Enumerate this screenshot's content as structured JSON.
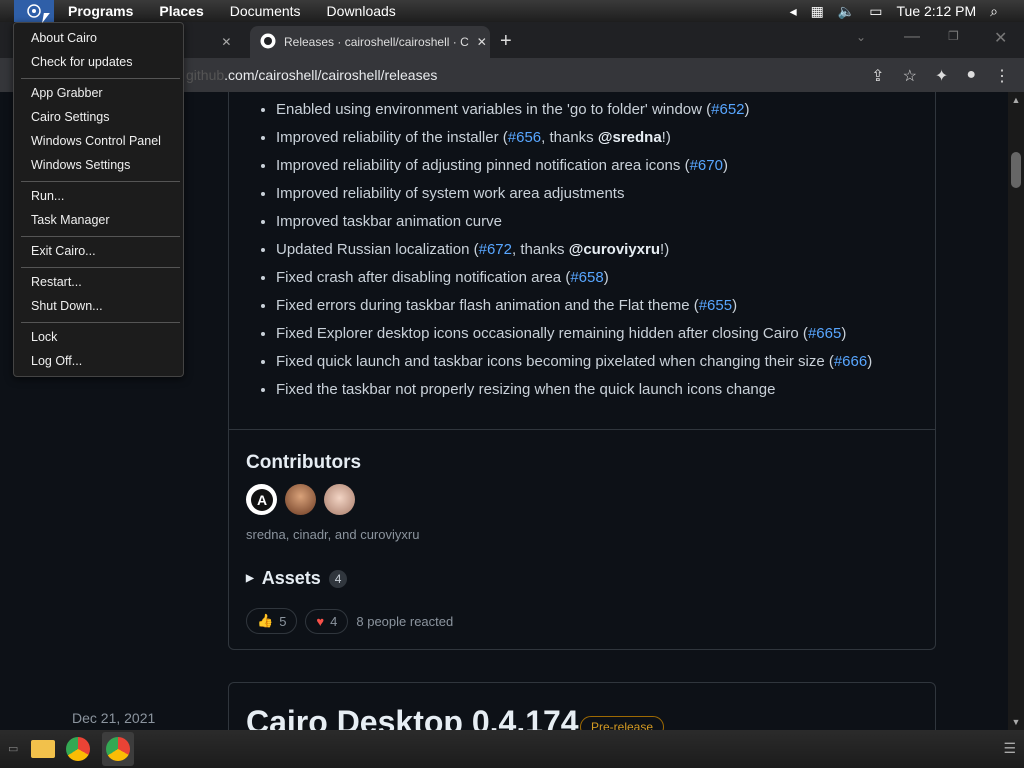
{
  "menubar": {
    "programs": "Programs",
    "places": "Places",
    "documents": "Documents",
    "downloads": "Downloads",
    "clock": "Tue 2:12 PM"
  },
  "tabs": [
    {
      "label": "t"
    },
    {
      "label": "Releases · cairoshell/cairoshell · C"
    }
  ],
  "address": {
    "host": "github",
    "path": ".com/cairoshell/cairoshell/releases"
  },
  "notes": [
    {
      "text": "Enabled using environment variables in the 'go to folder' window (",
      "link": "#652",
      "tail": ")"
    },
    {
      "text": "Improved reliability of the installer (",
      "link": "#656",
      "mid": ", thanks ",
      "user": "@sredna",
      "tail": "!)"
    },
    {
      "text": "Improved reliability of adjusting pinned notification area icons (",
      "link": "#670",
      "tail": ")"
    },
    {
      "text": "Improved reliability of system work area adjustments"
    },
    {
      "text": "Improved taskbar animation curve"
    },
    {
      "text": "Updated Russian localization (",
      "link": "#672",
      "mid": ", thanks ",
      "user": "@curoviyxru",
      "tail": "!)"
    },
    {
      "text": "Fixed crash after disabling notification area (",
      "link": "#658",
      "tail": ")"
    },
    {
      "text": "Fixed errors during taskbar flash animation and the Flat theme (",
      "link": "#655",
      "tail": ")"
    },
    {
      "text": "Fixed Explorer desktop icons occasionally remaining hidden after closing Cairo (",
      "link": "#665",
      "tail": ")"
    },
    {
      "text": "Fixed quick launch and taskbar icons becoming pixelated when changing their size (",
      "link": "#666",
      "tail": ")"
    },
    {
      "text": "Fixed the taskbar not properly resizing when the quick launch icons change"
    }
  ],
  "contributors": {
    "title": "Contributors",
    "names": "sredna, cinadr, and curoviyxru"
  },
  "assets": {
    "label": "Assets",
    "count": "4"
  },
  "reactions": {
    "thumbs_count": "5",
    "heart_count": "4",
    "summary": "8 people reacted"
  },
  "next_release": {
    "date": "Dec 21, 2021",
    "title": "Cairo Desktop 0.4.174",
    "badge": "Pre-release"
  },
  "menu": {
    "about": "About Cairo",
    "check_updates": "Check for updates",
    "app_grabber": "App Grabber",
    "cairo_settings": "Cairo Settings",
    "control_panel": "Windows Control Panel",
    "windows_settings": "Windows Settings",
    "run": "Run...",
    "task_manager": "Task Manager",
    "exit": "Exit Cairo...",
    "restart": "Restart...",
    "shutdown": "Shut Down...",
    "lock": "Lock",
    "logoff": "Log Off..."
  },
  "colors": {
    "link": "#58a6ff",
    "bg": "#0d1117",
    "accent": "#2f5fa8"
  }
}
